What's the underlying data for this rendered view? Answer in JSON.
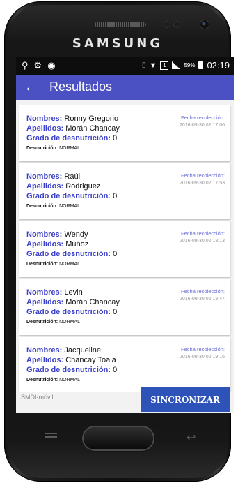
{
  "device": {
    "brand": "SAMSUNG"
  },
  "statusbar": {
    "left_icons": [
      "location-icon",
      "usb-icon",
      "chat-icon"
    ],
    "right_icons": [
      "vibrate-icon",
      "wifi-icon",
      "sim-icon",
      "signal-icon",
      "battery-icon"
    ],
    "battery_percent": "59%",
    "time": "02:19"
  },
  "appbar": {
    "back_icon": "arrow-left-icon",
    "title": "Resultados"
  },
  "labels": {
    "nombres": "Nombres:",
    "apellidos": "Apellidos:",
    "grado": "Grado de desnutrición:",
    "desnutricion": "Desnutrición:",
    "fecha": "Fecha recolección:"
  },
  "results": [
    {
      "nombres": "Ronny Gregorio",
      "apellidos": "Morán Chancay",
      "grado": "0",
      "desnutricion": "NORMAL",
      "fecha": "2016-09-30 02:17:06"
    },
    {
      "nombres": "Raúl",
      "apellidos": "Rodriguez",
      "grado": "0",
      "desnutricion": "NORMAL",
      "fecha": "2016-09-30 02:17:53"
    },
    {
      "nombres": "Wendy",
      "apellidos": "Muñoz",
      "grado": "0",
      "desnutricion": "NORMAL",
      "fecha": "2016-09-30 02:18:13"
    },
    {
      "nombres": "Levin",
      "apellidos": "Morán Chancay",
      "grado": "0",
      "desnutricion": "NORMAL",
      "fecha": "2016-09-30 02:18:47"
    },
    {
      "nombres": "Jacqueline",
      "apellidos": "Chancay Toala",
      "grado": "0",
      "desnutricion": "NORMAL",
      "fecha": "2016-09-30 02:19:16"
    }
  ],
  "footer": {
    "label": "SMDI-móvil",
    "sync_button": "SINCRONIZAR"
  },
  "colors": {
    "primary": "#4b51c2",
    "label": "#3b40c8",
    "button": "#2d52b8"
  }
}
